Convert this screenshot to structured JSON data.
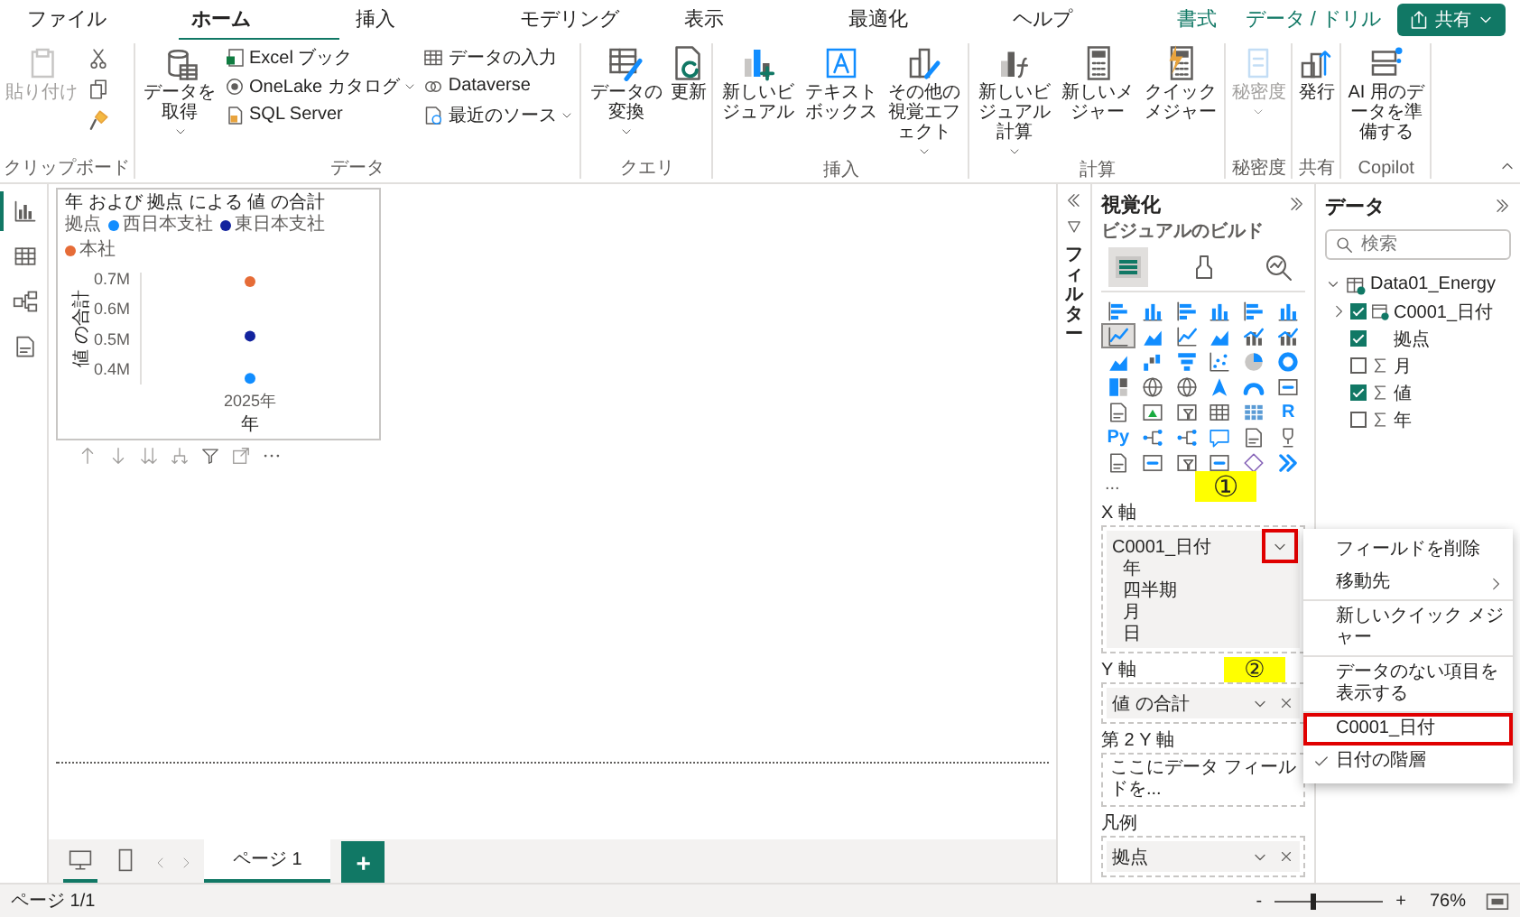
{
  "ribbon": {
    "tabs": [
      {
        "label": "ファイル",
        "selected": false,
        "kind": "main"
      },
      {
        "label": "ホーム",
        "selected": true,
        "kind": "main"
      },
      {
        "label": "挿入",
        "selected": false,
        "kind": "main"
      },
      {
        "label": "モデリング",
        "selected": false,
        "kind": "main"
      },
      {
        "label": "表示",
        "selected": false,
        "kind": "main"
      },
      {
        "label": "最適化",
        "selected": false,
        "kind": "main"
      },
      {
        "label": "ヘルプ",
        "selected": false,
        "kind": "main"
      },
      {
        "label": "書式",
        "selected": false,
        "kind": "contextual"
      },
      {
        "label": "データ / ドリル",
        "selected": false,
        "kind": "contextual"
      }
    ],
    "share_button": "共有",
    "groups": [
      {
        "title": "クリップボード",
        "items": [
          {
            "kind": "large",
            "label": "貼り付け",
            "disabled": true,
            "caret": false
          },
          {
            "kind": "tools"
          }
        ]
      },
      {
        "title": "データ",
        "items": [
          {
            "kind": "large",
            "label": "データを取得",
            "disabled": false,
            "caret": true
          },
          {
            "kind": "stack",
            "items": [
              {
                "label": "Excel ブック",
                "caret": false
              },
              {
                "label": "OneLake カタログ",
                "caret": true
              },
              {
                "label": "SQL Server",
                "caret": false
              }
            ]
          },
          {
            "kind": "stack",
            "items": [
              {
                "label": "データの入力",
                "caret": false
              },
              {
                "label": "Dataverse",
                "caret": false
              },
              {
                "label": "最近のソース",
                "caret": true
              }
            ]
          }
        ]
      },
      {
        "title": "クエリ",
        "items": [
          {
            "kind": "large",
            "label": "データの変換",
            "disabled": false,
            "caret": true
          },
          {
            "kind": "large",
            "label": "更新",
            "disabled": false,
            "caret": false
          }
        ]
      },
      {
        "title": "挿入",
        "items": [
          {
            "kind": "large",
            "label": "新しいビジュアル",
            "disabled": false,
            "caret": false
          },
          {
            "kind": "large",
            "label": "テキストボックス",
            "disabled": false,
            "caret": false
          },
          {
            "kind": "large",
            "label": "その他の視覚エフェクト",
            "disabled": false,
            "caret": true
          }
        ]
      },
      {
        "title": "計算",
        "items": [
          {
            "kind": "large",
            "label": "新しいビジュアル計算",
            "disabled": false,
            "caret": true
          },
          {
            "kind": "large",
            "label": "新しいメジャー",
            "disabled": false,
            "caret": false
          },
          {
            "kind": "large",
            "label": "クイックメジャー",
            "disabled": false,
            "caret": false
          }
        ]
      },
      {
        "title": "秘密度",
        "items": [
          {
            "kind": "large",
            "label": "秘密度",
            "disabled": true,
            "caret": true
          }
        ]
      },
      {
        "title": "共有",
        "items": [
          {
            "kind": "large",
            "label": "発行",
            "disabled": false,
            "caret": false
          }
        ]
      },
      {
        "title": "Copilot",
        "items": [
          {
            "kind": "large",
            "label": "AI 用のデータを準備する",
            "disabled": false,
            "caret": false
          }
        ]
      }
    ]
  },
  "rail": [
    {
      "selected": true
    },
    {
      "selected": false
    },
    {
      "selected": false
    },
    {
      "selected": false
    }
  ],
  "report": {
    "visual": {
      "legend_title": "拠点",
      "chart_data": {
        "type": "line",
        "title": "年 および 拠点 による 値 の合計",
        "xlabel": "年",
        "ylabel": "値 の合計",
        "categories": [
          "2025年"
        ],
        "series": [
          {
            "name": "西日本支社",
            "color": "#118dff",
            "marker": "circle",
            "values": [
              0.37
            ]
          },
          {
            "name": "東日本支社",
            "color": "#12239e",
            "marker": "circle",
            "values": [
              0.51
            ]
          },
          {
            "name": "本社",
            "color": "#e66c37",
            "marker": "circle",
            "values": [
              0.69
            ]
          }
        ],
        "ylim": [
          0.35,
          0.72
        ],
        "yticks": [
          {
            "value": 0.4,
            "label": "0.4M"
          },
          {
            "value": 0.5,
            "label": "0.5M"
          },
          {
            "value": 0.6,
            "label": "0.6M"
          },
          {
            "value": 0.7,
            "label": "0.7M"
          }
        ]
      }
    },
    "layout_views": [
      {
        "selected": true
      },
      {
        "selected": false
      }
    ],
    "pages": [
      {
        "label": "ページ 1",
        "selected": true
      }
    ],
    "add_page": "+"
  },
  "filters": {
    "label": "フィルター"
  },
  "visualizations": {
    "title": "視覚化",
    "subtitle": "ビジュアルのビルド",
    "tabs": [
      {
        "selected": true
      },
      {
        "selected": false
      },
      {
        "selected": false
      }
    ],
    "gallery": [
      {
        "kind": "icon",
        "selected": false
      },
      {
        "kind": "icon",
        "selected": false
      },
      {
        "kind": "icon",
        "selected": false
      },
      {
        "kind": "icon",
        "selected": false
      },
      {
        "kind": "icon",
        "selected": false
      },
      {
        "kind": "icon",
        "selected": false
      },
      {
        "kind": "icon",
        "selected": true
      },
      {
        "kind": "icon",
        "selected": false
      },
      {
        "kind": "icon",
        "selected": false
      },
      {
        "kind": "icon",
        "selected": false
      },
      {
        "kind": "icon",
        "selected": false
      },
      {
        "kind": "icon",
        "selected": false
      },
      {
        "kind": "icon",
        "selected": false
      },
      {
        "kind": "icon",
        "selected": false
      },
      {
        "kind": "icon",
        "selected": false
      },
      {
        "kind": "icon",
        "selected": false
      },
      {
        "kind": "icon",
        "selected": false
      },
      {
        "kind": "icon",
        "selected": false
      },
      {
        "kind": "icon",
        "selected": false
      },
      {
        "kind": "icon",
        "selected": false
      },
      {
        "kind": "icon",
        "selected": false
      },
      {
        "kind": "icon",
        "selected": false
      },
      {
        "kind": "icon",
        "selected": false
      },
      {
        "kind": "icon",
        "selected": false
      },
      {
        "kind": "icon",
        "selected": false
      },
      {
        "kind": "icon",
        "selected": false
      },
      {
        "kind": "icon",
        "selected": false
      },
      {
        "kind": "icon",
        "selected": false
      },
      {
        "kind": "icon",
        "selected": false
      },
      {
        "kind": "text",
        "label": "R",
        "selected": false
      },
      {
        "kind": "text",
        "label": "Py",
        "selected": false
      },
      {
        "kind": "icon",
        "selected": false
      },
      {
        "kind": "icon",
        "selected": false
      },
      {
        "kind": "icon",
        "selected": false
      },
      {
        "kind": "icon",
        "selected": false
      },
      {
        "kind": "icon",
        "selected": false
      },
      {
        "kind": "icon",
        "selected": false
      },
      {
        "kind": "icon",
        "selected": false
      },
      {
        "kind": "icon",
        "selected": false
      },
      {
        "kind": "icon",
        "selected": false
      },
      {
        "kind": "icon",
        "selected": false
      },
      {
        "kind": "icon",
        "selected": false
      }
    ],
    "more_button": "...",
    "wells": [
      {
        "label": "X 軸",
        "fields": [
          {
            "label": "C0001_日付",
            "children": [
              "年",
              "四半期",
              "月",
              "日"
            ],
            "caret_highlighted": true,
            "removable": false
          }
        ]
      },
      {
        "label": "Y 軸",
        "fields": [
          {
            "label": "値 の合計",
            "caret_highlighted": false,
            "removable": true
          }
        ]
      },
      {
        "label": "第 2 Y 軸",
        "placeholder": "ここにデータ フィールドを..."
      },
      {
        "label": "凡例",
        "fields": [
          {
            "label": "拠点",
            "caret_highlighted": false,
            "removable": true
          }
        ]
      }
    ]
  },
  "data_pane": {
    "title": "データ",
    "search": {
      "placeholder": "検索"
    },
    "tree": [
      {
        "label": "Data01_Energy",
        "kind": "table",
        "expanded": true,
        "children": [
          {
            "label": "C0001_日付",
            "kind": "hierarchy",
            "expanded": false,
            "checked": true
          },
          {
            "label": "拠点",
            "kind": "text",
            "checked": true
          },
          {
            "label": "月",
            "kind": "numeric",
            "checked": false
          },
          {
            "label": "値",
            "kind": "numeric",
            "checked": true
          },
          {
            "label": "年",
            "kind": "numeric",
            "checked": false
          }
        ]
      }
    ]
  },
  "context_menu": {
    "items": [
      {
        "label": "フィールドを削除",
        "submenu": false,
        "checked": false,
        "highlighted": false,
        "divider_after": false
      },
      {
        "label": "移動先",
        "submenu": true,
        "checked": false,
        "highlighted": false,
        "divider_after": true
      },
      {
        "label": "新しいクイック メジャー",
        "submenu": false,
        "checked": false,
        "highlighted": false,
        "divider_after": true
      },
      {
        "label": "データのない項目を表示する",
        "submenu": false,
        "checked": false,
        "highlighted": false,
        "divider_after": true
      },
      {
        "label": "C0001_日付",
        "submenu": false,
        "checked": false,
        "highlighted": true,
        "divider_after": false
      },
      {
        "label": "日付の階層",
        "submenu": false,
        "checked": true,
        "highlighted": false,
        "divider_after": false
      }
    ]
  },
  "callouts": [
    "①",
    "②"
  ],
  "status_bar": {
    "page_info": "ページ 1/1",
    "zoom": {
      "minus": "-",
      "plus": "+",
      "level": 0.35,
      "reading": "76%"
    }
  }
}
